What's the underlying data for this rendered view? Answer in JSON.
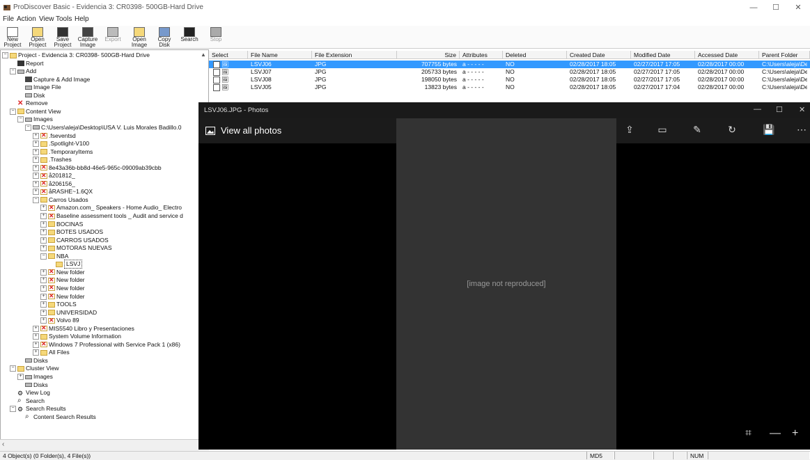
{
  "window": {
    "title": "ProDiscover Basic - Evidencia 3: CR0398- 500GB-Hard Drive",
    "min": "—",
    "max": "☐",
    "close": "✕"
  },
  "menu": [
    "File",
    "Action",
    "View",
    "Tools",
    "Help"
  ],
  "toolbar": [
    {
      "label": "New\nProject",
      "icon": "new-project-icon",
      "enabled": true
    },
    {
      "label": "Open\nProject",
      "icon": "open-project-icon",
      "enabled": true
    },
    {
      "label": "Save\nProject",
      "icon": "save-project-icon",
      "enabled": true
    },
    {
      "label": "Capture\nImage",
      "icon": "capture-image-icon",
      "enabled": true
    },
    {
      "label": "Export",
      "icon": "export-icon",
      "enabled": false
    },
    {
      "label": "Open\nImage",
      "icon": "open-image-icon",
      "enabled": true
    },
    {
      "label": "Copy\nDisk",
      "icon": "copy-disk-icon",
      "enabled": true
    },
    {
      "label": "Search",
      "icon": "search-icon",
      "enabled": true
    },
    {
      "label": "Stop",
      "icon": "stop-icon",
      "enabled": false
    }
  ],
  "tree": [
    {
      "label": "Project - Evidencia 3: CR0398- 500GB-Hard Drive",
      "level": 0,
      "exp": "−",
      "icon": "folder"
    },
    {
      "label": "Report",
      "level": 1,
      "exp": "",
      "icon": "report"
    },
    {
      "label": "Add",
      "level": 1,
      "exp": "−",
      "icon": "drive"
    },
    {
      "label": "Capture & Add Image",
      "level": 2,
      "exp": "",
      "icon": "capture"
    },
    {
      "label": "Image File",
      "level": 2,
      "exp": "",
      "icon": "drive"
    },
    {
      "label": "Disk",
      "level": 2,
      "exp": "",
      "icon": "drive"
    },
    {
      "label": "Remove",
      "level": 1,
      "exp": "",
      "icon": "remove"
    },
    {
      "label": "Content View",
      "level": 1,
      "exp": "−",
      "icon": "folder"
    },
    {
      "label": "Images",
      "level": 2,
      "exp": "−",
      "icon": "drive"
    },
    {
      "label": "C:\\Users\\aleja\\Desktop\\USA V. Luis Morales Badillo.0",
      "level": 3,
      "exp": "−",
      "icon": "drive"
    },
    {
      "label": ".fseventsd",
      "level": 4,
      "exp": "+",
      "icon": "xfolder"
    },
    {
      "label": ".Spotlight-V100",
      "level": 4,
      "exp": "+",
      "icon": "folder"
    },
    {
      "label": ".TemporaryItems",
      "level": 4,
      "exp": "+",
      "icon": "folder"
    },
    {
      "label": ".Trashes",
      "level": 4,
      "exp": "+",
      "icon": "folder"
    },
    {
      "label": "8e43a36b-bb8d-46e5-965c-09009ab39cbb",
      "level": 4,
      "exp": "+",
      "icon": "xfolder"
    },
    {
      "label": "å201812_",
      "level": 4,
      "exp": "+",
      "icon": "xfolder"
    },
    {
      "label": "å206156_",
      "level": 4,
      "exp": "+",
      "icon": "xfolder"
    },
    {
      "label": "åRASHE~1.6QX",
      "level": 4,
      "exp": "+",
      "icon": "xfolder"
    },
    {
      "label": "Carros Usados",
      "level": 4,
      "exp": "−",
      "icon": "folder"
    },
    {
      "label": "Amazon.com_ Speakers - Home Audio_ Electro",
      "level": 5,
      "exp": "+",
      "icon": "xfolder"
    },
    {
      "label": "Baseline assessment tools _ Audit and service d",
      "level": 5,
      "exp": "+",
      "icon": "xfolder"
    },
    {
      "label": "BOCINAS",
      "level": 5,
      "exp": "+",
      "icon": "folder"
    },
    {
      "label": "BOTES USADOS",
      "level": 5,
      "exp": "+",
      "icon": "folder"
    },
    {
      "label": "CARROS USADOS",
      "level": 5,
      "exp": "+",
      "icon": "folder"
    },
    {
      "label": "MOTORAS NUEVAS",
      "level": 5,
      "exp": "+",
      "icon": "folder"
    },
    {
      "label": "NBA",
      "level": 5,
      "exp": "−",
      "icon": "folder"
    },
    {
      "label": "LSVJ",
      "level": 6,
      "exp": "",
      "icon": "folder",
      "selected": true
    },
    {
      "label": "New folder",
      "level": 5,
      "exp": "+",
      "icon": "xfolder"
    },
    {
      "label": "New folder",
      "level": 5,
      "exp": "+",
      "icon": "xfolder"
    },
    {
      "label": "New folder",
      "level": 5,
      "exp": "+",
      "icon": "xfolder"
    },
    {
      "label": "New folder",
      "level": 5,
      "exp": "+",
      "icon": "xfolder"
    },
    {
      "label": "TOOLS",
      "level": 5,
      "exp": "+",
      "icon": "folder"
    },
    {
      "label": "UNIVERSIDAD",
      "level": 5,
      "exp": "+",
      "icon": "folder"
    },
    {
      "label": "Volvo 89",
      "level": 5,
      "exp": "+",
      "icon": "xfolder"
    },
    {
      "label": "MIS5540 Libro y Presentaciones",
      "level": 4,
      "exp": "+",
      "icon": "xfolder"
    },
    {
      "label": "System Volume Information",
      "level": 4,
      "exp": "+",
      "icon": "folder"
    },
    {
      "label": "Windows 7 Professional with Service Pack 1 (x86)",
      "level": 4,
      "exp": "+",
      "icon": "xfolder"
    },
    {
      "label": "All Files",
      "level": 4,
      "exp": "+",
      "icon": "folder"
    },
    {
      "label": "Disks",
      "level": 2,
      "exp": "",
      "icon": "drive"
    },
    {
      "label": "Cluster View",
      "level": 1,
      "exp": "−",
      "icon": "folder"
    },
    {
      "label": "Images",
      "level": 2,
      "exp": "+",
      "icon": "drive"
    },
    {
      "label": "Disks",
      "level": 2,
      "exp": "",
      "icon": "drive"
    },
    {
      "label": "View Log",
      "level": 1,
      "exp": "",
      "icon": "log"
    },
    {
      "label": "Search",
      "level": 1,
      "exp": "",
      "icon": "search"
    },
    {
      "label": "Search Results",
      "level": 1,
      "exp": "−",
      "icon": "log"
    },
    {
      "label": "Content Search Results",
      "level": 2,
      "exp": "",
      "icon": "search"
    }
  ],
  "table": {
    "headers": [
      "Select",
      "File Name",
      "File Extension",
      "Size",
      "Attributes",
      "Deleted",
      "Created Date",
      "Modified Date",
      "Accessed Date",
      "Parent Folder"
    ],
    "rows": [
      {
        "name": "LSVJ06",
        "ext": "JPG",
        "size": "707755 bytes",
        "attr": "a - - - - -",
        "deleted": "NO",
        "created": "02/28/2017 18:05",
        "modified": "02/27/2017 17:05",
        "accessed": "02/28/2017 00:00",
        "parent": "C:\\Users\\aleja\\Des",
        "selected": true
      },
      {
        "name": "LSVJ07",
        "ext": "JPG",
        "size": "205733 bytes",
        "attr": "a - - - - -",
        "deleted": "NO",
        "created": "02/28/2017 18:05",
        "modified": "02/27/2017 17:05",
        "accessed": "02/28/2017 00:00",
        "parent": "C:\\Users\\aleja\\Des",
        "selected": false
      },
      {
        "name": "LSVJ08",
        "ext": "JPG",
        "size": "198050 bytes",
        "attr": "a - - - - -",
        "deleted": "NO",
        "created": "02/28/2017 18:05",
        "modified": "02/27/2017 17:05",
        "accessed": "02/28/2017 00:00",
        "parent": "C:\\Users\\aleja\\Des",
        "selected": false
      },
      {
        "name": "LSVJ05",
        "ext": "JPG",
        "size": "13823 bytes",
        "attr": "a - - - - -",
        "deleted": "NO",
        "created": "02/28/2017 18:05",
        "modified": "02/27/2017 17:04",
        "accessed": "02/28/2017 00:00",
        "parent": "C:\\Users\\aleja\\Des",
        "selected": false
      }
    ]
  },
  "photos": {
    "title": "LSVJ06.JPG - Photos",
    "view_all": "View all photos",
    "commands": [
      "share-icon",
      "slideshow-icon",
      "edit-icon",
      "rotate-icon",
      "save-icon",
      "more-icon"
    ],
    "bottom": [
      "fit-icon",
      "zoom-out-icon",
      "zoom-in-icon"
    ]
  },
  "status": {
    "text": "4 Object(s) (0 Folder(s), 4 File(s))",
    "md5": "MD5",
    "num": "NUM"
  }
}
